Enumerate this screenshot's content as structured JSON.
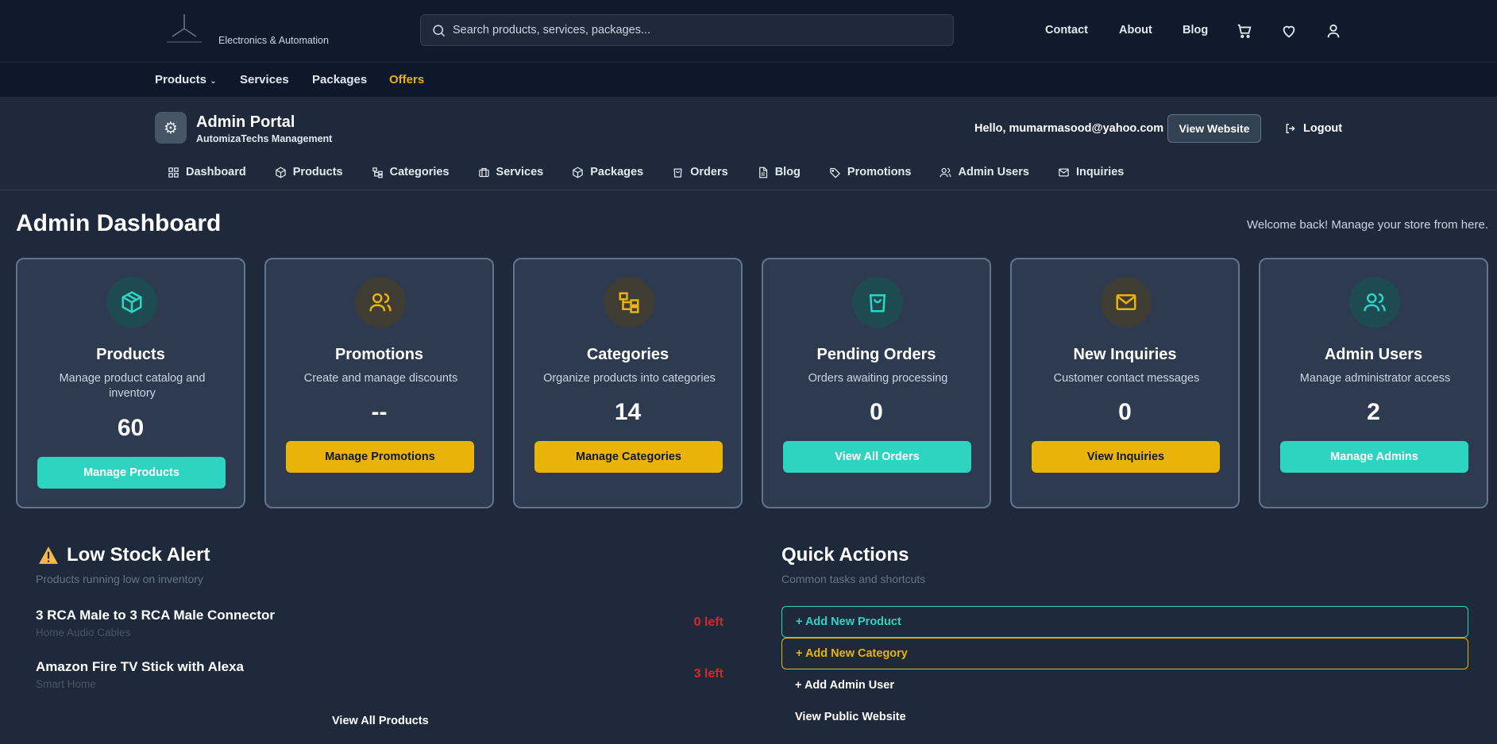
{
  "header": {
    "tagline": "Electronics & Automation",
    "search_placeholder": "Search products, services, packages...",
    "links": [
      "Contact",
      "About",
      "Blog"
    ]
  },
  "catnav": {
    "products": "Products",
    "services": "Services",
    "packages": "Packages",
    "offers": "Offers"
  },
  "admin": {
    "title": "Admin Portal",
    "subtitle": "AutomizaTechs Management",
    "hello": "Hello, mumarmasood@yahoo.com",
    "view_website": "View Website",
    "logout": "Logout",
    "tabs": [
      "Dashboard",
      "Products",
      "Categories",
      "Services",
      "Packages",
      "Orders",
      "Blog",
      "Promotions",
      "Admin Users",
      "Inquiries"
    ]
  },
  "main": {
    "title": "Admin Dashboard",
    "welcome": "Welcome back! Manage your store from here."
  },
  "cards": [
    {
      "title": "Products",
      "desc": "Manage product catalog and inventory",
      "value": "60",
      "button": "Manage Products"
    },
    {
      "title": "Promotions",
      "desc": "Create and manage discounts",
      "value": "--",
      "button": "Manage Promotions"
    },
    {
      "title": "Categories",
      "desc": "Organize products into categories",
      "value": "14",
      "button": "Manage Categories"
    },
    {
      "title": "Pending Orders",
      "desc": "Orders awaiting processing",
      "value": "0",
      "button": "View All Orders"
    },
    {
      "title": "New Inquiries",
      "desc": "Customer contact messages",
      "value": "0",
      "button": "View Inquiries"
    },
    {
      "title": "Admin Users",
      "desc": "Manage administrator access",
      "value": "2",
      "button": "Manage Admins"
    }
  ],
  "low_stock": {
    "title": "Low Stock Alert",
    "subtitle": "Products running low on inventory",
    "items": [
      {
        "name": "3 RCA Male to 3 RCA Male Connector",
        "category": "Home Audio Cables",
        "left": "0 left"
      },
      {
        "name": "Amazon Fire TV Stick with Alexa",
        "category": "Smart Home",
        "left": "3 left"
      }
    ],
    "view_all": "View All Products"
  },
  "quick_actions": {
    "title": "Quick Actions",
    "subtitle": "Common tasks and shortcuts",
    "actions": [
      "+ Add New Product",
      "+ Add New Category",
      "+ Add Admin User",
      "View Public Website"
    ]
  },
  "colors": {
    "background": "#1e293b",
    "teal": "#2dd4bf",
    "gold": "#eab308",
    "danger": "#dc2626"
  }
}
